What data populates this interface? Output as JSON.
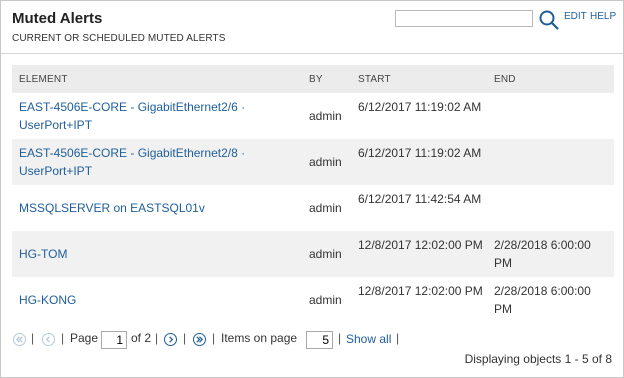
{
  "header": {
    "title": "Muted Alerts",
    "subtitle": "CURRENT OR SCHEDULED MUTED ALERTS",
    "search_value": "",
    "edit_label": "EDIT",
    "help_label": "HELP"
  },
  "table": {
    "columns": {
      "element": "ELEMENT",
      "by": "BY",
      "start": "START",
      "end": "END"
    },
    "rows": [
      {
        "element": "EAST-4506E-CORE - GigabitEthernet2/6 · UserPort+IPT",
        "by": "admin",
        "start": "6/12/2017 11:19:02 AM",
        "end": ""
      },
      {
        "element": "EAST-4506E-CORE - GigabitEthernet2/8 · UserPort+IPT",
        "by": "admin",
        "start": "6/12/2017 11:19:02 AM",
        "end": ""
      },
      {
        "element": "MSSQLSERVER on EASTSQL01v",
        "by": "admin",
        "start": "6/12/2017 11:42:54 AM",
        "end": ""
      },
      {
        "element": "HG-TOM",
        "by": "admin",
        "start": "12/8/2017 12:02:00 PM",
        "end": "2/28/2018 6:00:00 PM"
      },
      {
        "element": "HG-KONG",
        "by": "admin",
        "start": "12/8/2017 12:02:00 PM",
        "end": "2/28/2018 6:00:00 PM"
      }
    ]
  },
  "pager": {
    "page_label": "Page",
    "page_value": "1",
    "of_label": "of 2",
    "items_label": "Items on page",
    "items_value": "5",
    "show_all_label": "Show all",
    "separator": "|"
  },
  "status": "Displaying objects 1 - 5 of 8",
  "colors": {
    "link": "#1f5e9a",
    "header_bg": "#ececec",
    "alt_row_bg": "#f1f1f1",
    "border": "#c8c8c8"
  },
  "icons": {
    "search": "magnifier-icon",
    "first": "first-page-icon",
    "prev": "previous-page-icon",
    "next": "next-page-icon",
    "last": "last-page-icon"
  }
}
